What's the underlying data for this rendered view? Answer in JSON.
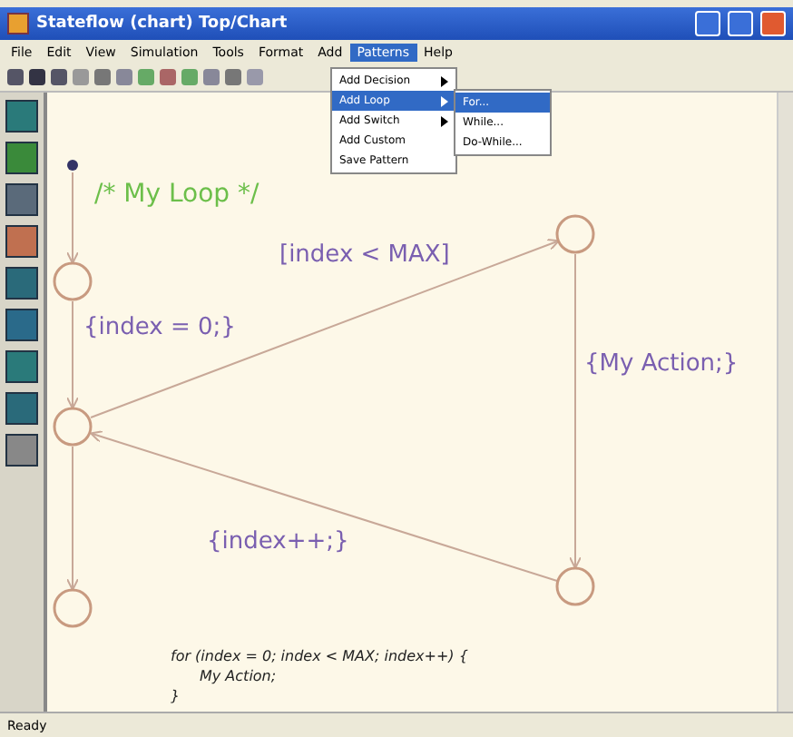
{
  "window": {
    "title": "Stateflow (chart) Top/Chart"
  },
  "menus": [
    {
      "label": "File",
      "selected": false
    },
    {
      "label": "Edit",
      "selected": false
    },
    {
      "label": "View",
      "selected": false
    },
    {
      "label": "Simulation",
      "selected": false
    },
    {
      "label": "Tools",
      "selected": false
    },
    {
      "label": "Format",
      "selected": false
    },
    {
      "label": "Add",
      "selected": false
    },
    {
      "label": "Patterns",
      "selected": true
    },
    {
      "label": "Help",
      "selected": false
    }
  ],
  "dropdown": {
    "items": [
      {
        "label": "Add Decision",
        "submenu": true,
        "selected": false
      },
      {
        "label": "Add Loop",
        "submenu": true,
        "selected": true
      },
      {
        "label": "Add Switch",
        "submenu": true,
        "selected": false
      },
      {
        "label": "Add Custom",
        "submenu": false,
        "selected": false
      },
      {
        "label": "Save Pattern",
        "submenu": false,
        "selected": false
      }
    ],
    "submenu": [
      {
        "label": "For...",
        "selected": true
      },
      {
        "label": "While...",
        "selected": false
      },
      {
        "label": "Do-While...",
        "selected": false
      }
    ]
  },
  "chart": {
    "comment": "/* My Loop */",
    "condition": "[index < MAX]",
    "init_action": "{index = 0;}",
    "loop_action": "{My Action;}",
    "increment": "{index++;}",
    "code": [
      "for (index = 0; index < MAX; index++) {",
      "My Action;",
      "}"
    ]
  },
  "status_bar": "Ready"
}
